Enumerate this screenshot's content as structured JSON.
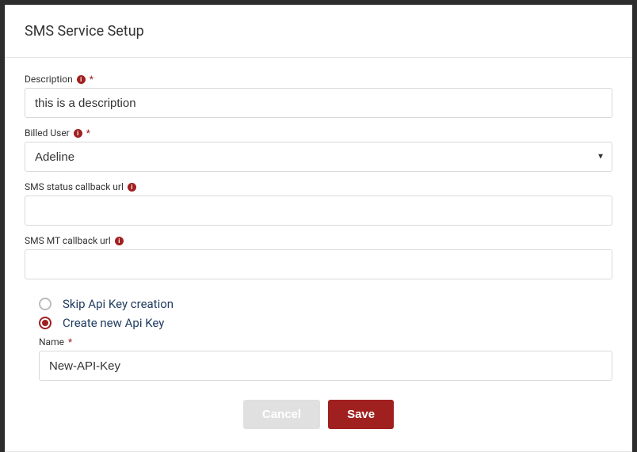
{
  "header": {
    "title": "SMS Service Setup"
  },
  "form": {
    "description": {
      "label": "Description",
      "value": "this is a description"
    },
    "billed_user": {
      "label": "Billed User",
      "value": "Adeline"
    },
    "sms_status_callback": {
      "label": "SMS status callback url",
      "value": ""
    },
    "sms_mt_callback": {
      "label": "SMS MT callback url",
      "value": ""
    },
    "api_key": {
      "skip_label": "Skip Api Key creation",
      "create_label": "Create new Api Key",
      "name_label": "Name",
      "name_value": "New-API-Key"
    }
  },
  "buttons": {
    "cancel": "Cancel",
    "save": "Save"
  }
}
